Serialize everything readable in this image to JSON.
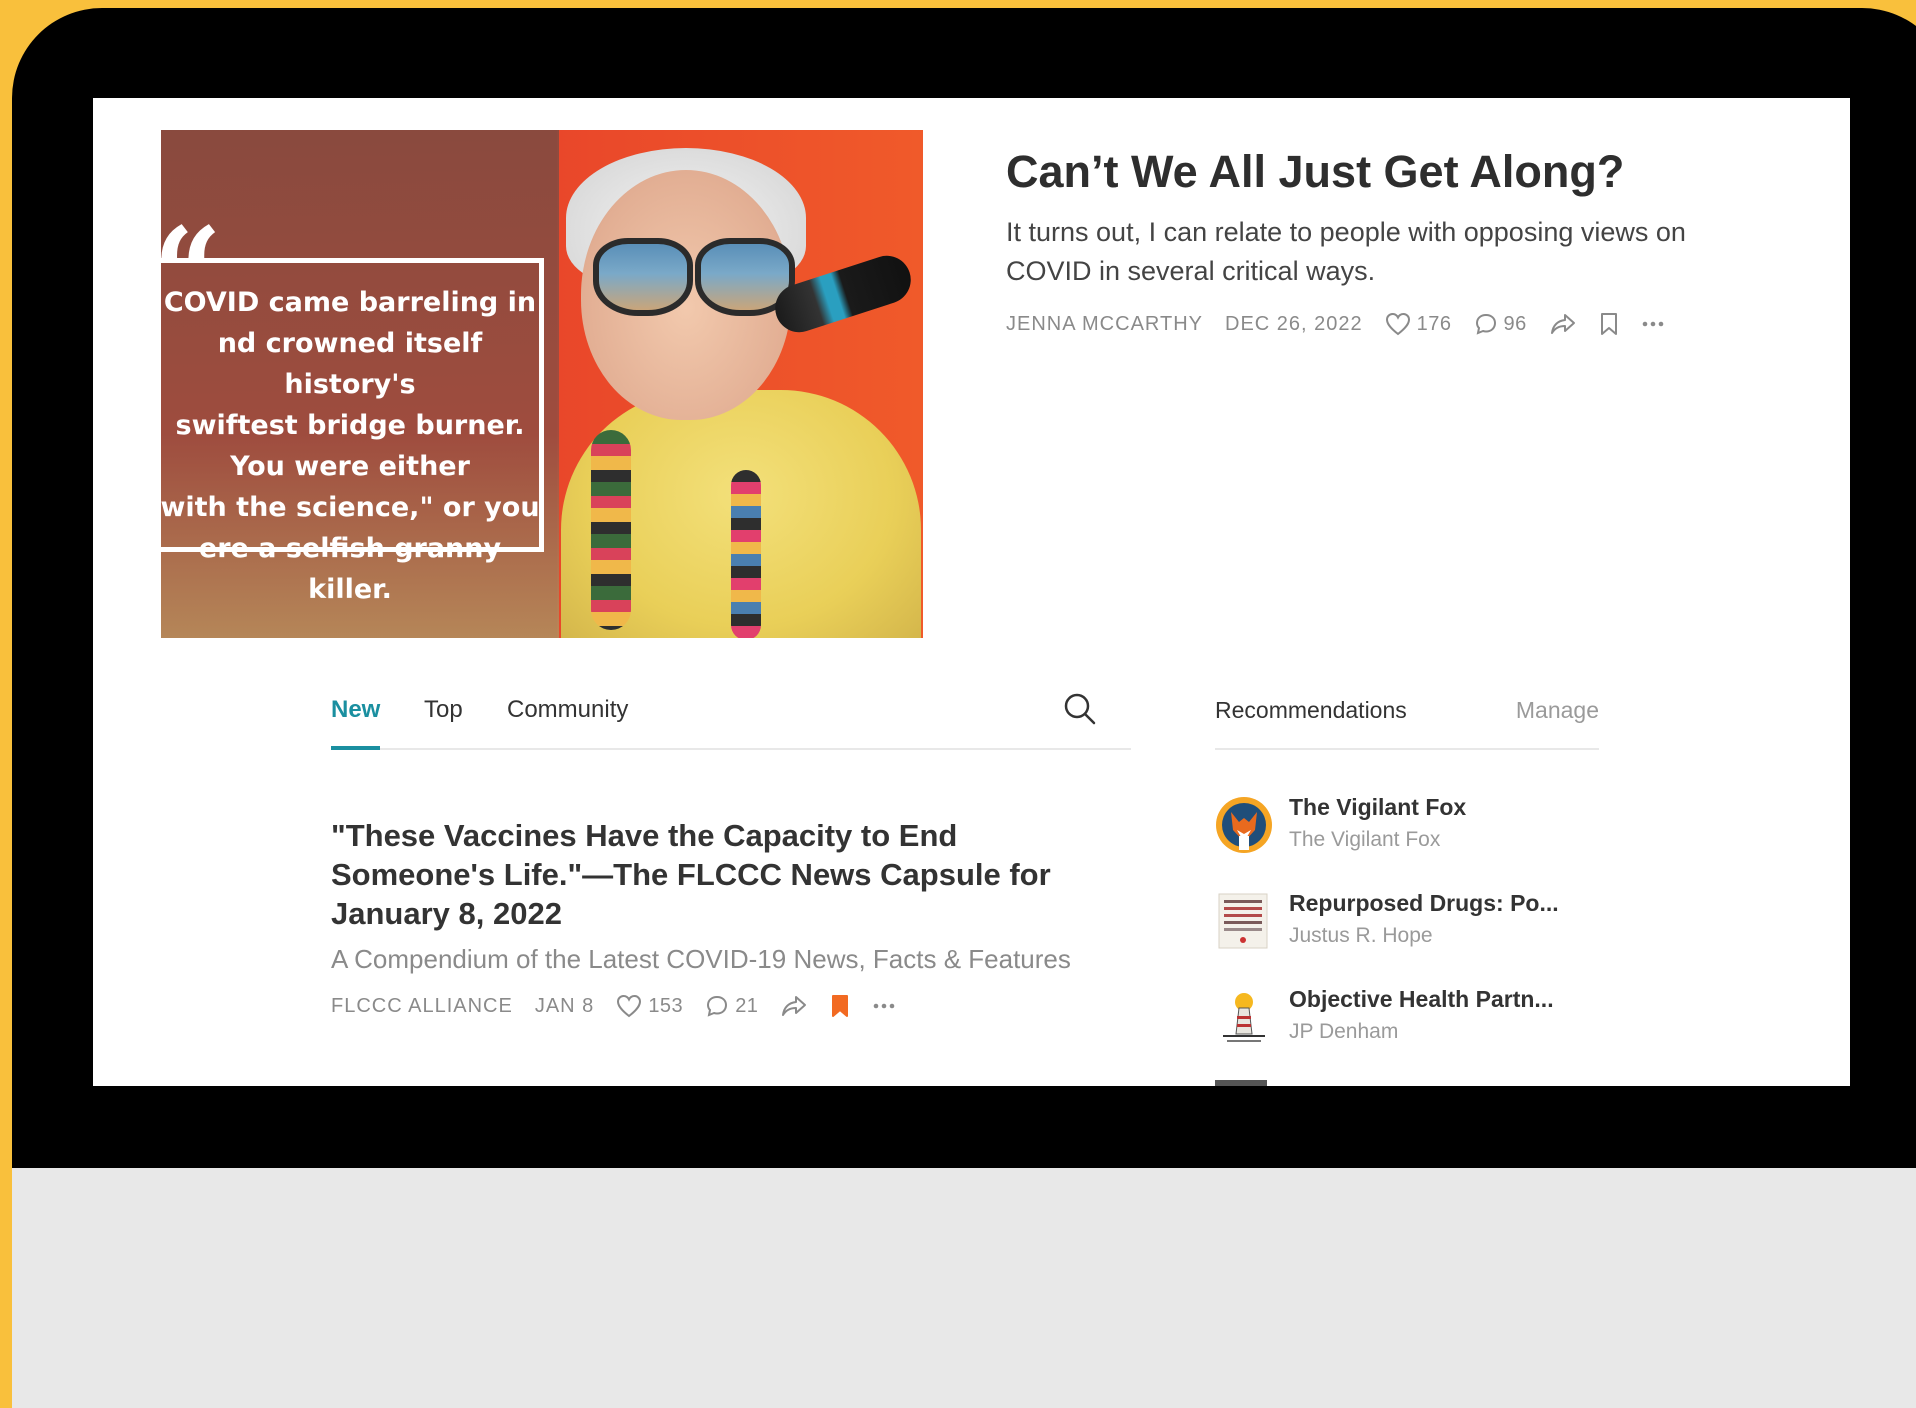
{
  "hero": {
    "quote_text": "COVID came barreling in\nnd crowned itself history's\nswiftest bridge burner.\nYou were either\nwith the science,\" or you\nere a selfish granny killer.",
    "title": "Can’t We All Just Get Along?",
    "subtitle": "It turns out, I can relate to people with opposing views on COVID in several critical ways.",
    "author": "JENNA MCCARTHY",
    "date": "DEC 26, 2022",
    "likes": "176",
    "comments": "96"
  },
  "tabs": [
    {
      "label": "New",
      "active": true
    },
    {
      "label": "Top",
      "active": false
    },
    {
      "label": "Community",
      "active": false
    }
  ],
  "post": {
    "title": "\"These Vaccines Have the Capacity to End Someone's Life.\"—The FLCCC News Capsule for January 8, 2022",
    "subtitle": "A Compendium of the Latest COVID-19 News, Facts & Features",
    "author": "FLCCC ALLIANCE",
    "date": "JAN 8",
    "likes": "153",
    "comments": "21",
    "bookmark_color": "#f26a22"
  },
  "recommendations": {
    "title": "Recommendations",
    "manage_label": "Manage",
    "items": [
      {
        "name": "The Vigilant Fox",
        "author": "The Vigilant Fox"
      },
      {
        "name": "Repurposed Drugs: Po...",
        "author": "Justus R. Hope"
      },
      {
        "name": "Objective Health Partn...",
        "author": "JP Denham"
      }
    ]
  },
  "colors": {
    "accent": "#1a8fa0",
    "frame": "#f9c03c"
  }
}
